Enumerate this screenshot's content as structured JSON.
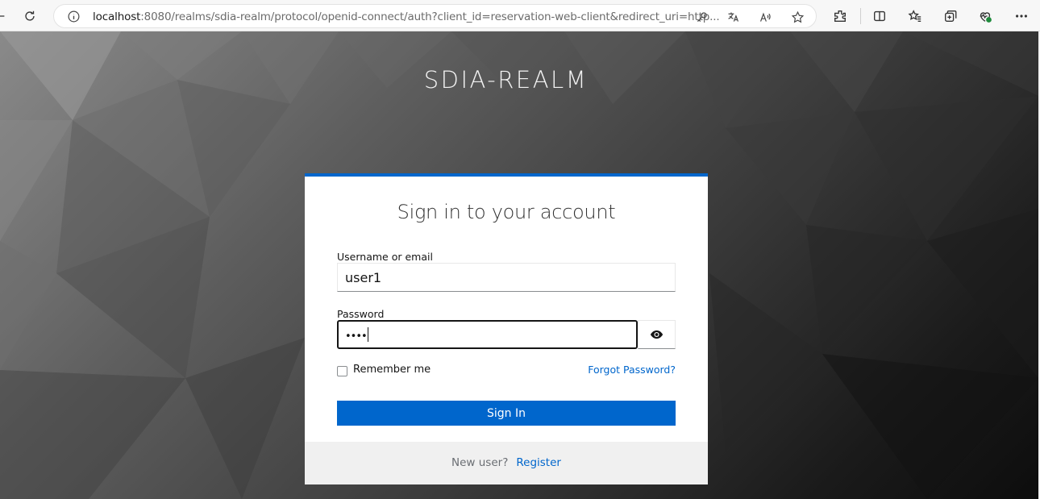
{
  "browser": {
    "url_host": "localhost",
    "url_rest": ":8080/realms/sdia-realm/protocol/openid-connect/auth?client_id=reservation-web-client&redirect_uri=http..."
  },
  "page": {
    "realm_title": "SDIA-REALM"
  },
  "login": {
    "title": "Sign in to your account",
    "username_label": "Username or email",
    "username_value": "user1",
    "password_label": "Password",
    "password_mask": "••••",
    "remember_label": "Remember me",
    "forgot_link": "Forgot Password?",
    "signin_label": "Sign In",
    "new_user_text": "New user?",
    "register_link": "Register"
  },
  "colors": {
    "accent": "#0066cc",
    "card_footer": "#f0f0f0"
  }
}
